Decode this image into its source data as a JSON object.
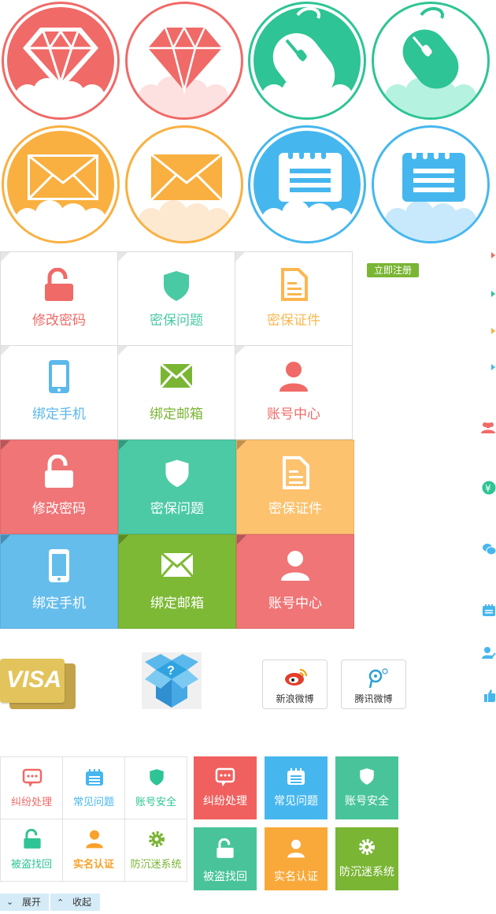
{
  "colors": {
    "red": "#f06a67",
    "green": "#2ec495",
    "orange": "#f9b040",
    "blue": "#46b7ee",
    "lightgreen": "#7ab534"
  },
  "icon_circles": [
    {
      "icon": "diamond-icon",
      "style": "filled",
      "color": "#f06a67"
    },
    {
      "icon": "diamond-icon",
      "style": "outline",
      "color": "#f06a67"
    },
    {
      "icon": "mouse-icon",
      "style": "filled",
      "color": "#2ec495"
    },
    {
      "icon": "mouse-icon",
      "style": "outline",
      "color": "#2ec495"
    },
    {
      "icon": "envelope-icon",
      "style": "filled",
      "color": "#f9b040"
    },
    {
      "icon": "envelope-icon",
      "style": "outline",
      "color": "#f9b040"
    },
    {
      "icon": "notepad-icon",
      "style": "filled",
      "color": "#46b7ee"
    },
    {
      "icon": "notepad-icon",
      "style": "outline",
      "color": "#46b7ee"
    }
  ],
  "register_button": "立即注册",
  "account_tiles": [
    {
      "label": "修改密码",
      "icon": "unlock-icon",
      "color": "#f06a67"
    },
    {
      "label": "密保问题",
      "icon": "shield-icon",
      "color": "#49c9a4"
    },
    {
      "label": "密保证件",
      "icon": "document-icon",
      "color": "#fbb74f"
    },
    {
      "label": "绑定手机",
      "icon": "phone-icon",
      "color": "#5bb8ec"
    },
    {
      "label": "绑定邮箱",
      "icon": "envelope-icon",
      "color": "#7ab534"
    },
    {
      "label": "账号中心",
      "icon": "user-icon",
      "color": "#f06a67"
    }
  ],
  "account_tiles_colored": [
    {
      "label": "修改密码",
      "icon": "unlock-icon",
      "color": "#f07577"
    },
    {
      "label": "密保问题",
      "icon": "shield-icon",
      "color": "#4ccaa6"
    },
    {
      "label": "密保证件",
      "icon": "document-icon",
      "color": "#fdc26e"
    },
    {
      "label": "绑定手机",
      "icon": "phone-icon",
      "color": "#65bdec"
    },
    {
      "label": "绑定邮箱",
      "icon": "envelope-icon",
      "color": "#7db935"
    },
    {
      "label": "账号中心",
      "icon": "user-icon",
      "color": "#f07577"
    }
  ],
  "visa_text": "VISA",
  "weibo_buttons": [
    {
      "label": "新浪微博",
      "icon": "sina-weibo-icon"
    },
    {
      "label": "腾讯微博",
      "icon": "tencent-weibo-icon"
    }
  ],
  "side_arrows": [
    "#f06a67",
    "#2ec495",
    "#f9b040",
    "#46b7ee"
  ],
  "side_icons": [
    {
      "icon": "users-icon",
      "color": "#f06a67"
    },
    {
      "icon": "yuan-icon",
      "color": "#2ec495"
    },
    {
      "icon": "chat-icon",
      "color": "#46b7ee"
    },
    {
      "icon": "calendar-icon",
      "color": "#46b7ee"
    },
    {
      "icon": "user-check-icon",
      "color": "#46b7ee"
    },
    {
      "icon": "thumbs-up-icon",
      "color": "#46b7ee"
    }
  ],
  "service_tiles": [
    {
      "label": "纠纷处理",
      "icon": "dispute-chat-icon",
      "color": "#f06a67"
    },
    {
      "label": "常见问题",
      "icon": "faq-notepad-icon",
      "color": "#46b7ee"
    },
    {
      "label": "账号安全",
      "icon": "shield-icon",
      "color": "#2ec495"
    },
    {
      "label": "被盗找回",
      "icon": "unlock-icon",
      "color": "#2ec495"
    },
    {
      "label": "实名认证",
      "icon": "user-icon",
      "color": "#f9a22a"
    },
    {
      "label": "防沉迷系统",
      "icon": "gear-icon",
      "color": "#7ab534"
    }
  ],
  "service_tiles_colored": [
    {
      "label": "纠纷处理",
      "icon": "dispute-chat-icon",
      "color": "#f0605e"
    },
    {
      "label": "常见问题",
      "icon": "faq-notepad-icon",
      "color": "#46b7ee"
    },
    {
      "label": "账号安全",
      "icon": "shield-icon",
      "color": "#49c49a"
    },
    {
      "label": "被盗找回",
      "icon": "unlock-icon",
      "color": "#49c49a"
    },
    {
      "label": "实名认证",
      "icon": "user-icon",
      "color": "#f9a93a"
    },
    {
      "label": "防沉迷系统",
      "icon": "gear-icon",
      "color": "#7ab534"
    }
  ],
  "expand_button": "展开",
  "collapse_button": "收起"
}
